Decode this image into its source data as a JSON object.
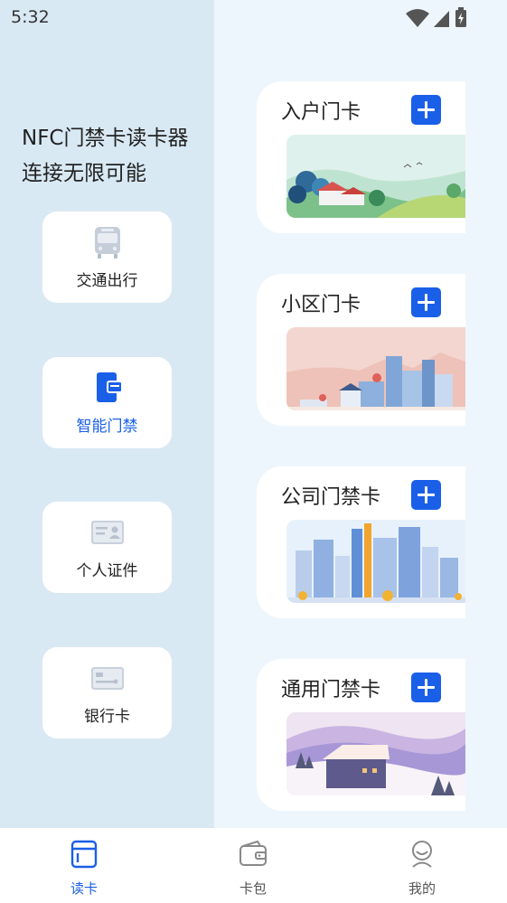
{
  "status_bar": {
    "time": "5:32"
  },
  "headline": {
    "line1": "NFC门禁卡读卡器",
    "line2": "连接无限可能"
  },
  "categories": [
    {
      "label": "交通出行",
      "icon": "bus-icon"
    },
    {
      "label": "智能门禁",
      "icon": "door-card-icon",
      "active": true
    },
    {
      "label": "个人证件",
      "icon": "id-card-icon"
    },
    {
      "label": "银行卡",
      "icon": "bank-card-icon"
    }
  ],
  "cards": [
    {
      "title": "入户门卡",
      "art": "green-hills-illustration"
    },
    {
      "title": "小区门卡",
      "art": "pink-city-illustration"
    },
    {
      "title": "公司门禁卡",
      "art": "office-towers-illustration"
    },
    {
      "title": "通用门禁卡",
      "art": "snowy-house-illustration"
    }
  ],
  "bottom_nav": [
    {
      "label": "读卡",
      "icon": "read-card-icon",
      "active": true
    },
    {
      "label": "卡包",
      "icon": "wallet-icon"
    },
    {
      "label": "我的",
      "icon": "profile-icon"
    }
  ],
  "colors": {
    "accent": "#1a5fe8",
    "left_panel": "#d9e9f4",
    "right_panel": "#eef6fd"
  }
}
